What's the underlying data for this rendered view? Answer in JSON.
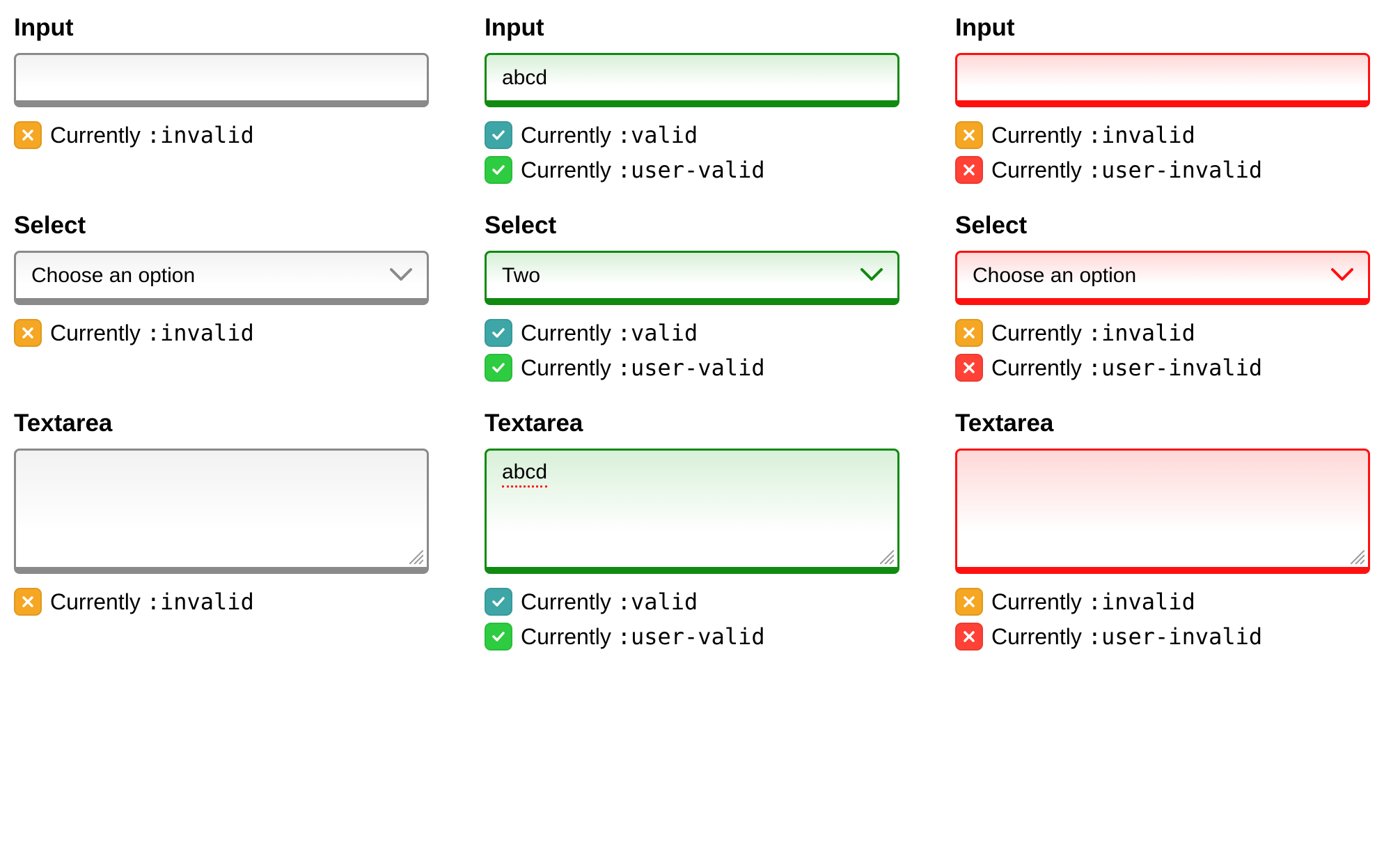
{
  "labels": {
    "input": "Input",
    "select": "Select",
    "textarea": "Textarea"
  },
  "status_text": {
    "prefix": "Currently ",
    "invalid": ":invalid",
    "valid": ":valid",
    "user_valid": ":user-valid",
    "user_invalid": ":user-invalid"
  },
  "icons": {
    "orange_x": "x-icon-orange",
    "teal_check": "check-icon-teal",
    "green_check": "check-icon-green",
    "red_x": "x-icon-red"
  },
  "columns": {
    "neutral": {
      "input_value": "",
      "select_value": "Choose an option",
      "textarea_value": ""
    },
    "valid": {
      "input_value": "abcd",
      "select_value": "Two",
      "textarea_value": "abcd"
    },
    "invalid_user": {
      "input_value": "",
      "select_value": "Choose an option",
      "textarea_value": ""
    }
  }
}
